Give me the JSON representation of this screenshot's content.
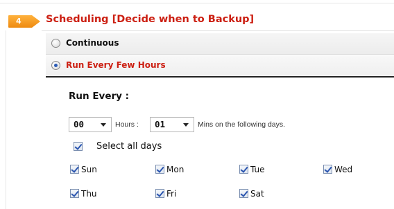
{
  "step": {
    "number": "4",
    "title": "Scheduling [Decide when to Backup]",
    "badge_color": "#f39a1e",
    "title_color": "#cc1f12"
  },
  "options": {
    "continuous": {
      "label": "Continuous",
      "selected": false
    },
    "run_every_few_hours": {
      "label": "Run Every Few Hours",
      "selected": true
    }
  },
  "run_every": {
    "heading": "Run Every :",
    "hours_value": "00",
    "hours_label": "Hours :",
    "mins_value": "01",
    "mins_label": "Mins on the following days."
  },
  "days": {
    "select_all_label": "Select all days",
    "select_all_checked": true,
    "items": [
      {
        "label": "Sun",
        "checked": true
      },
      {
        "label": "Mon",
        "checked": true
      },
      {
        "label": "Tue",
        "checked": true
      },
      {
        "label": "Wed",
        "checked": true
      },
      {
        "label": "Thu",
        "checked": true
      },
      {
        "label": "Fri",
        "checked": true
      },
      {
        "label": "Sat",
        "checked": true
      }
    ]
  },
  "icons": {
    "badge": "arrow-badge-icon",
    "radio": "radio-button-icon",
    "checkbox": "checkbox-icon",
    "dropdown": "chevron-down-icon"
  }
}
